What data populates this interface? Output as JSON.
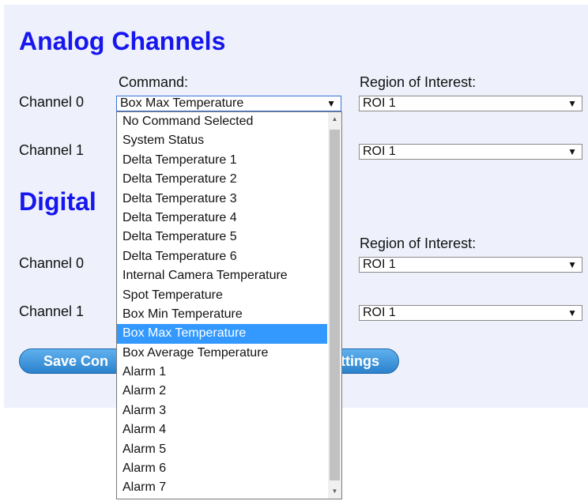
{
  "analog": {
    "title": "Analog Channels",
    "command_label": "Command:",
    "roi_label": "Region of Interest:",
    "channel0_label": "Channel 0",
    "channel1_label": "Channel 1",
    "channel0_command": "Box Max Temperature",
    "channel0_roi": "ROI 1",
    "channel1_roi": "ROI 1"
  },
  "digital": {
    "title": "Digital",
    "roi_label": "Region of Interest:",
    "channel0_label": "Channel 0",
    "channel1_label": "Channel 1",
    "channel0_roi": "ROI 1",
    "channel1_roi": "ROI 1"
  },
  "buttons": {
    "save_label": "Save Con",
    "load_label": "ttings"
  },
  "dropdown": {
    "options": [
      "No Command Selected",
      "System Status",
      "Delta Temperature 1",
      "Delta Temperature 2",
      "Delta Temperature 3",
      "Delta Temperature 4",
      "Delta Temperature 5",
      "Delta Temperature 6",
      "Internal Camera Temperature",
      "Spot Temperature",
      "Box Min Temperature",
      "Box Max Temperature",
      "Box Average Temperature",
      "Alarm 1",
      "Alarm 2",
      "Alarm 3",
      "Alarm 4",
      "Alarm 5",
      "Alarm 6",
      "Alarm 7"
    ],
    "selected": "Box Max Temperature"
  },
  "icons": {
    "dropdown_arrow": "▼",
    "scroll_up": "▲",
    "scroll_down": "▼"
  },
  "colors": {
    "title": "#1616ee",
    "panel_bg": "#eef1fb",
    "selection": "#3399ff",
    "button": "#2b82cc"
  }
}
